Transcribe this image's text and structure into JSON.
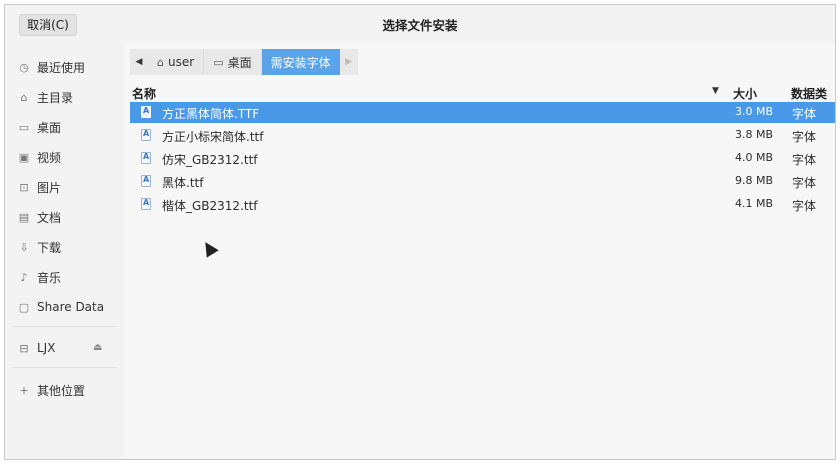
{
  "header": {
    "cancel_label": "取消(C)",
    "title": "选择文件安装"
  },
  "sidebar": {
    "items": [
      {
        "icon": "clock-icon",
        "label": "最近使用"
      },
      {
        "icon": "home-icon",
        "label": "主目录"
      },
      {
        "icon": "desktop-icon",
        "label": "桌面"
      },
      {
        "icon": "video-icon",
        "label": "视频"
      },
      {
        "icon": "image-icon",
        "label": "图片"
      },
      {
        "icon": "document-icon",
        "label": "文档"
      },
      {
        "icon": "download-icon",
        "label": "下载"
      },
      {
        "icon": "music-icon",
        "label": "音乐"
      },
      {
        "icon": "folder-icon",
        "label": "Share Data"
      }
    ],
    "drive": {
      "icon": "drive-icon",
      "label": "LJX"
    },
    "other": {
      "icon": "plus-icon",
      "label": "其他位置"
    }
  },
  "pathbar": {
    "crumbs": [
      {
        "icon": "home-icon",
        "label": "user"
      },
      {
        "icon": "desktop-icon",
        "label": "桌面"
      },
      {
        "label": "需安装字体"
      }
    ]
  },
  "columns": {
    "name": "名称",
    "size": "大小",
    "type": "数据类型"
  },
  "files": [
    {
      "name": "方正黑体简体.TTF",
      "size": "3.0 MB",
      "type": "字体",
      "selected": true
    },
    {
      "name": "方正小标宋简体.ttf",
      "size": "3.8 MB",
      "type": "字体",
      "selected": false
    },
    {
      "name": "仿宋_GB2312.ttf",
      "size": "4.0 MB",
      "type": "字体",
      "selected": false
    },
    {
      "name": "黑体.ttf",
      "size": "9.8 MB",
      "type": "字体",
      "selected": false
    },
    {
      "name": "楷体_GB2312.ttf",
      "size": "4.1 MB",
      "type": "字体",
      "selected": false
    }
  ],
  "colors": {
    "accent": "#4a98e8",
    "crumb_active": "#5aa3e6"
  }
}
